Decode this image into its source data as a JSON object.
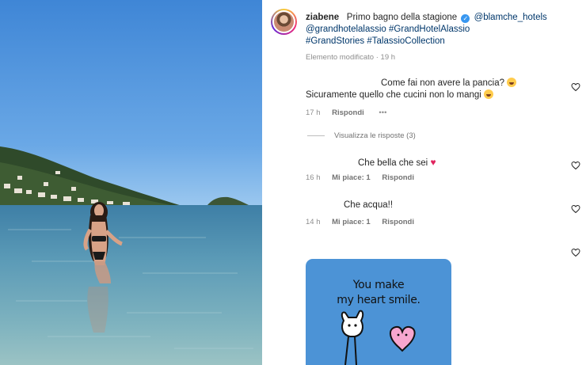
{
  "post": {
    "username": "ziabene",
    "caption_text": "Primo bagno della stagione",
    "tags": [
      "@blamche_hotels",
      "@grandhotelalassio",
      "#GrandHotelAlassio",
      "#GrandStories",
      "#TalassioCollection"
    ],
    "edited_label": "Elemento modificato",
    "separator": "·",
    "time": "19 h"
  },
  "comments": [
    {
      "line1": "Come fai non avere la pancia?",
      "line2": "Sicuramente quello che cucini non lo mangi",
      "time": "17 h",
      "reply": "Rispondi",
      "more": "•••",
      "view_replies": "Visualizza le risposte (3)"
    },
    {
      "text": "Che bella che sei",
      "time": "16 h",
      "likes": "Mi piace: 1",
      "reply": "Rispondi"
    },
    {
      "text": "Che acqua!!",
      "time": "14 h",
      "likes": "Mi piace: 1",
      "reply": "Rispondi"
    }
  ],
  "sticker": {
    "line1": "You make",
    "line2": "my heart smile."
  },
  "colors": {
    "link": "#00376b",
    "muted": "#8e8e8e",
    "sticker_bg": "#4c93d6",
    "heart": "#e0245e"
  },
  "icons": [
    "verified-badge-icon",
    "heart-outline-icon",
    "heart-emoji-icon",
    "laughing-emoji-icon",
    "surprised-emoji-icon"
  ]
}
